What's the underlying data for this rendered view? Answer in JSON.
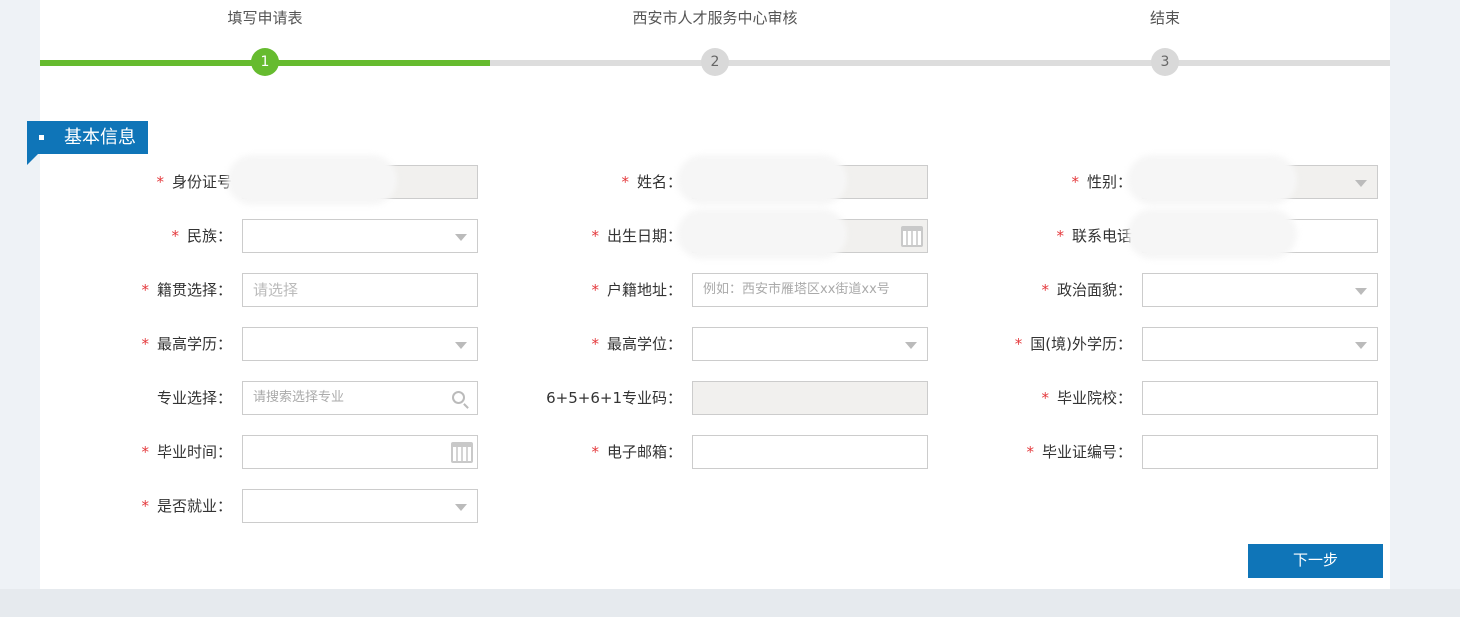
{
  "steps": [
    {
      "label": "填写申请表",
      "number": "1",
      "status": "active"
    },
    {
      "label": "西安市人才服务中心审核",
      "number": "2",
      "status": "pending"
    },
    {
      "label": "结束",
      "number": "3",
      "status": "pending"
    }
  ],
  "colors": {
    "active": "#66bb2f",
    "pending": "#dddddd",
    "primary": "#0f75b8",
    "required": "#e4393c"
  },
  "section_title": "基本信息",
  "required_mark": "*",
  "fields": [
    {
      "col": 0,
      "row": 0,
      "label": "身份证号",
      "required": true,
      "type": "text",
      "readonly": true,
      "blurred": true
    },
    {
      "col": 1,
      "row": 0,
      "label": "姓名：",
      "required": true,
      "type": "text",
      "readonly": true,
      "blurred": true
    },
    {
      "col": 2,
      "row": 0,
      "label": "性别：",
      "required": true,
      "type": "select",
      "readonly": true,
      "blurred": true
    },
    {
      "col": 0,
      "row": 1,
      "label": "民族：",
      "required": true,
      "type": "select"
    },
    {
      "col": 1,
      "row": 1,
      "label": "出生日期：",
      "required": true,
      "type": "date",
      "readonly": true,
      "blurred": true
    },
    {
      "col": 2,
      "row": 1,
      "label": "联系电话",
      "required": true,
      "type": "text",
      "blurred": true
    },
    {
      "col": 0,
      "row": 2,
      "label": "籍贯选择：",
      "required": true,
      "type": "text",
      "placeholder": "请选择"
    },
    {
      "col": 1,
      "row": 2,
      "label": "户籍地址：",
      "required": true,
      "type": "text",
      "placeholder": "例如：西安市雁塔区xx街道xx号"
    },
    {
      "col": 2,
      "row": 2,
      "label": "政治面貌：",
      "required": true,
      "type": "select"
    },
    {
      "col": 0,
      "row": 3,
      "label": "最高学历：",
      "required": true,
      "type": "select"
    },
    {
      "col": 1,
      "row": 3,
      "label": "最高学位：",
      "required": true,
      "type": "select"
    },
    {
      "col": 2,
      "row": 3,
      "label": "国(境)外学历：",
      "required": true,
      "type": "select"
    },
    {
      "col": 0,
      "row": 4,
      "label": "专业选择：",
      "required": false,
      "type": "search",
      "placeholder": "请搜索选择专业"
    },
    {
      "col": 1,
      "row": 4,
      "label": "6+5+6+1专业码：",
      "required": false,
      "type": "text",
      "readonly": true
    },
    {
      "col": 2,
      "row": 4,
      "label": "毕业院校：",
      "required": true,
      "type": "text"
    },
    {
      "col": 0,
      "row": 5,
      "label": "毕业时间：",
      "required": true,
      "type": "date"
    },
    {
      "col": 1,
      "row": 5,
      "label": "电子邮箱：",
      "required": true,
      "type": "text"
    },
    {
      "col": 2,
      "row": 5,
      "label": "毕业证编号：",
      "required": true,
      "type": "text"
    },
    {
      "col": 0,
      "row": 6,
      "label": "是否就业：",
      "required": true,
      "type": "select"
    }
  ],
  "next_button": "下一步"
}
